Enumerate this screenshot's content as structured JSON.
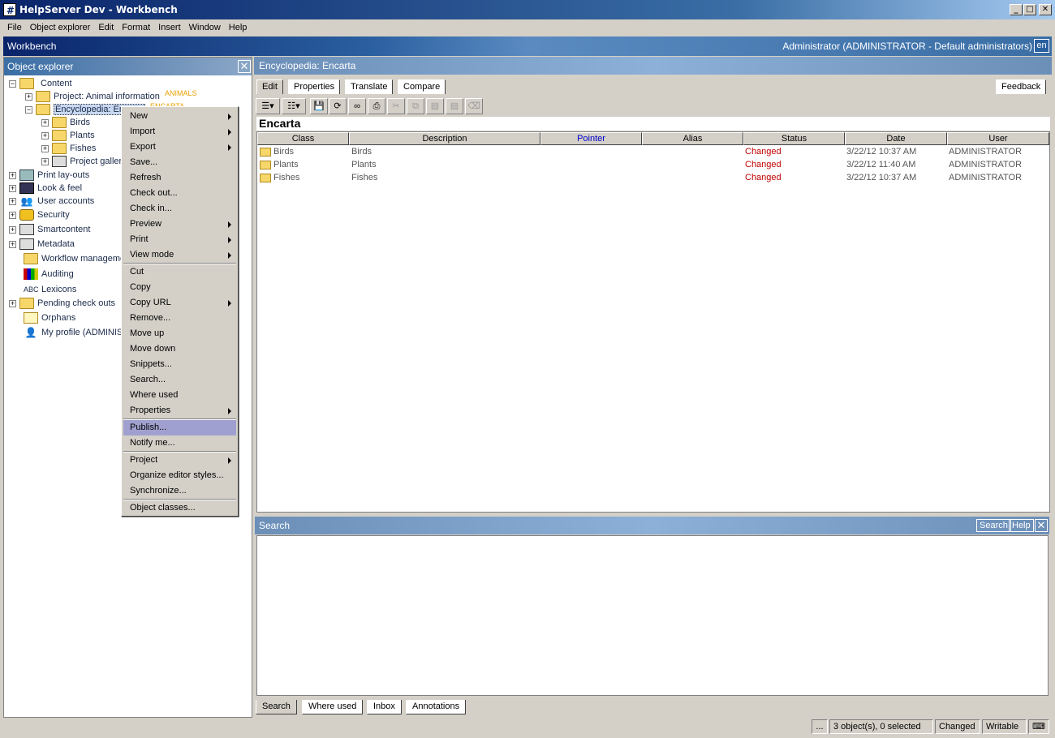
{
  "window": {
    "title": "HelpServer Dev - Workbench",
    "icon_glyph": "#"
  },
  "menubar": [
    "File",
    "Object explorer",
    "Edit",
    "Format",
    "Insert",
    "Window",
    "Help"
  ],
  "workbench": {
    "title": "Workbench",
    "user": "Administrator (ADMINISTRATOR - Default administrators)",
    "lang": "en"
  },
  "object_explorer": {
    "title": "Object explorer",
    "tree": [
      {
        "label": "Content"
      },
      {
        "label": "Project: Animal information",
        "tag": "ANIMALS"
      },
      {
        "label": "Encyclopedia: Encarta",
        "tag": "ENCARTA"
      },
      {
        "label": "Birds"
      },
      {
        "label": "Plants"
      },
      {
        "label": "Fishes"
      },
      {
        "label": "Project gallery"
      },
      {
        "label": "Print lay-outs"
      },
      {
        "label": "Look & feel"
      },
      {
        "label": "User accounts"
      },
      {
        "label": "Security"
      },
      {
        "label": "Smartcontent"
      },
      {
        "label": "Metadata"
      },
      {
        "label": "Workflow management"
      },
      {
        "label": "Auditing"
      },
      {
        "label": "Lexicons"
      },
      {
        "label": "Pending check outs"
      },
      {
        "label": "Orphans"
      },
      {
        "label": "My profile (ADMINISTRATOR)"
      }
    ]
  },
  "context_menu": {
    "items": [
      {
        "label": "New",
        "submenu": true
      },
      {
        "label": "Import",
        "submenu": true
      },
      {
        "label": "Export",
        "submenu": true
      },
      {
        "label": "Save..."
      },
      {
        "label": "Refresh"
      },
      {
        "label": "Check out..."
      },
      {
        "label": "Check in..."
      },
      {
        "label": "Preview",
        "submenu": true
      },
      {
        "label": "Print",
        "submenu": true
      },
      {
        "label": "View mode",
        "submenu": true
      },
      {
        "label": "Cut"
      },
      {
        "label": "Copy"
      },
      {
        "label": "Copy URL",
        "submenu": true
      },
      {
        "label": "Remove..."
      },
      {
        "label": "Move up"
      },
      {
        "label": "Move down"
      },
      {
        "label": "Snippets..."
      },
      {
        "label": "Search..."
      },
      {
        "label": "Where used"
      },
      {
        "label": "Properties",
        "submenu": true
      },
      {
        "label": "Publish...",
        "highlighted": true
      },
      {
        "label": "Notify me..."
      },
      {
        "label": "Project",
        "submenu": true
      },
      {
        "label": "Organize editor styles..."
      },
      {
        "label": "Synchronize..."
      },
      {
        "label": "Object classes..."
      }
    ]
  },
  "editor": {
    "header": "Encyclopedia: Encarta",
    "tabs": [
      "Edit",
      "Properties",
      "Translate",
      "Compare"
    ],
    "feedback_label": "Feedback",
    "title": "Encarta",
    "columns": [
      "Class",
      "Description",
      "Pointer",
      "Alias",
      "Status",
      "Date",
      "User"
    ],
    "rows": [
      {
        "class": "Birds",
        "description": "Birds",
        "pointer": "",
        "alias": "",
        "status": "Changed",
        "date": "3/22/12 10:37 AM",
        "user": "ADMINISTRATOR"
      },
      {
        "class": "Plants",
        "description": "Plants",
        "pointer": "",
        "alias": "",
        "status": "Changed",
        "date": "3/22/12 11:40 AM",
        "user": "ADMINISTRATOR"
      },
      {
        "class": "Fishes",
        "description": "Fishes",
        "pointer": "",
        "alias": "",
        "status": "Changed",
        "date": "3/22/12 10:37 AM",
        "user": "ADMINISTRATOR"
      }
    ],
    "status_color": "#c00000",
    "pointer_color": "#0000cc"
  },
  "search_panel": {
    "title": "Search",
    "search_btn": "Search",
    "help_btn": "Help"
  },
  "bottom_tabs": [
    "Search",
    "Where used",
    "Inbox",
    "Annotations"
  ],
  "statusbar": {
    "dots": "...",
    "selection": "3 object(s), 0 selected",
    "state": "Changed",
    "mode": "Writable"
  }
}
